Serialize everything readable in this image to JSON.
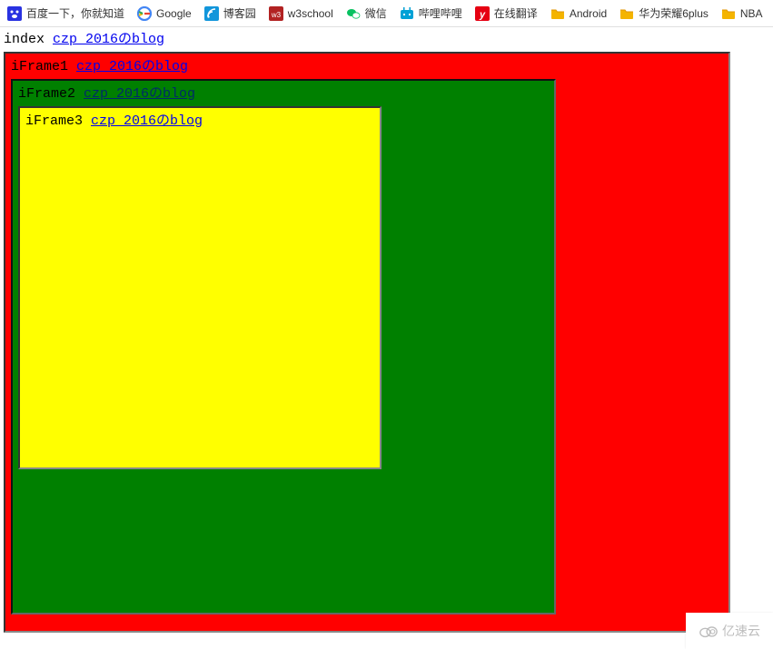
{
  "bookmarks": {
    "items": [
      {
        "label": "百度一下，你就知道",
        "icon": "baidu"
      },
      {
        "label": "Google",
        "icon": "google"
      },
      {
        "label": "博客园",
        "icon": "cnblogs"
      },
      {
        "label": "w3school",
        "icon": "w3"
      },
      {
        "label": "微信",
        "icon": "wechat"
      },
      {
        "label": "哔哩哔哩",
        "icon": "bilibili"
      },
      {
        "label": "在线翻译",
        "icon": "youdao"
      },
      {
        "label": "Android",
        "icon": "folder"
      },
      {
        "label": "华为荣耀6plus",
        "icon": "folder"
      },
      {
        "label": "NBA",
        "icon": "folder"
      }
    ]
  },
  "page": {
    "index_label": "index",
    "index_link": "czp 2016のblog",
    "frame1_label": "iFrame1",
    "frame1_link": "czp 2016のblog",
    "frame2_label": "iFrame2",
    "frame2_link": "czp 2016のblog",
    "frame3_label": "iFrame3",
    "frame3_link": "czp 2016のblog"
  },
  "colors": {
    "frame1_bg": "#ff0000",
    "frame2_bg": "#008000",
    "frame3_bg": "#ffff00",
    "link": "#0000ee"
  },
  "watermark": {
    "text": "亿速云"
  }
}
